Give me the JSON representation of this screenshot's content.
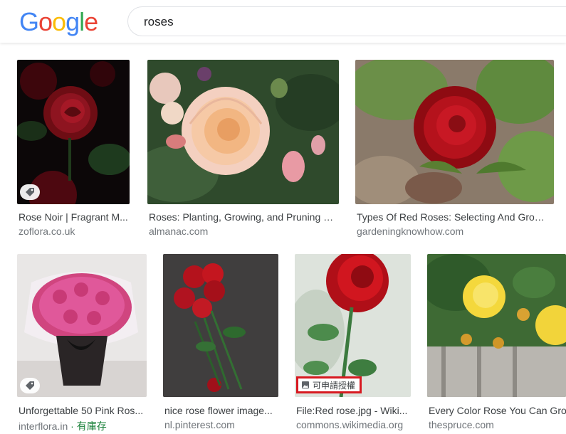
{
  "header": {
    "logo_letters": [
      {
        "ch": "G",
        "color": "#4285F4"
      },
      {
        "ch": "o",
        "color": "#EA4335"
      },
      {
        "ch": "o",
        "color": "#FBBC05"
      },
      {
        "ch": "g",
        "color": "#4285F4"
      },
      {
        "ch": "l",
        "color": "#34A853"
      },
      {
        "ch": "e",
        "color": "#EA4335"
      }
    ],
    "search_value": "roses"
  },
  "results": [
    {
      "caption": "Rose Noir | Fragrant M...",
      "source": "zoflora.co.uk",
      "badge": "tag-icon"
    },
    {
      "caption": "Roses: Planting, Growing, and Pruning R...",
      "source": "almanac.com"
    },
    {
      "caption": "Types Of Red Roses: Selecting And Growi...",
      "source": "gardeningknowhow.com"
    },
    {
      "caption": "Unforgettable 50 Pink Ros...",
      "source": "interflora.in",
      "source_extra": " · 有庫存",
      "badge": "tag-icon"
    },
    {
      "caption": "nice rose flower image...",
      "source": "nl.pinterest.com"
    },
    {
      "caption": "File:Red rose.jpg - Wiki...",
      "source": "commons.wikimedia.org",
      "license_label": "可申請授權"
    },
    {
      "caption": "Every Color Rose You Can Grow",
      "source": "thespruce.com"
    }
  ],
  "colors": {
    "caption": "#3c4043",
    "source": "#70757a",
    "instock": "#188038",
    "license_border": "#d71920"
  }
}
